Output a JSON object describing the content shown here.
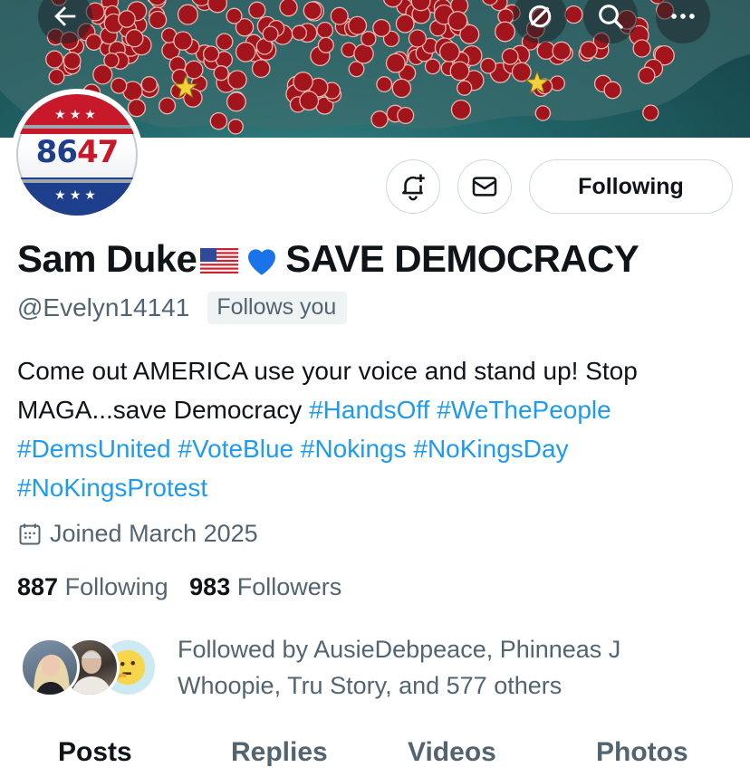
{
  "profile": {
    "name": "Sam Duke",
    "name_suffix": "SAVE DEMOCRACY",
    "flag_emoji": "us-flag",
    "heart_emoji": "blue-heart",
    "handle": "@Evelyn14141",
    "follows_you": "Follows you",
    "avatar_text_a": "86",
    "avatar_text_b": "47",
    "bio_text": "Come out AMERICA use your voice and stand up! Stop MAGA...save Democracy",
    "hashtags": [
      "#HandsOff",
      "#WeThePeople",
      "#DemsUnited",
      "#VoteBlue",
      "#Nokings",
      "#NoKingsDay",
      "#NoKingsProtest"
    ],
    "joined": "Joined March 2025",
    "following_count": "887",
    "following_label": "Following",
    "followers_count": "983",
    "followers_label": "Followers",
    "followed_by": "Followed by AusieDebpeace, Phinneas J Whoopie, Tru Story, and 577 others"
  },
  "actions": {
    "following_button": "Following"
  },
  "tabs": [
    "Posts",
    "Replies",
    "Videos",
    "Photos"
  ],
  "active_tab": "Posts",
  "icons": [
    "back-arrow-icon",
    "grok-icon",
    "search-icon",
    "more-icon",
    "notification-bell-icon",
    "message-envelope-icon",
    "calendar-icon"
  ],
  "colors": {
    "accent": "#1d9bf0",
    "muted_text": "#536471",
    "banner_dot": "#a3151c",
    "banner_bg": "#1f5f63"
  }
}
